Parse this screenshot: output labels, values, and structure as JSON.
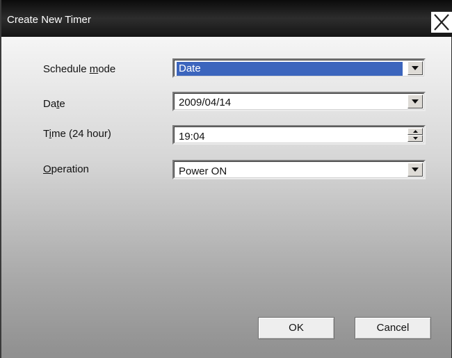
{
  "window": {
    "title": "Create New Timer",
    "close_icon": "close-x-icon"
  },
  "fields": {
    "schedule_mode": {
      "label_pre": "Schedule ",
      "label_accel": "m",
      "label_post": "ode",
      "value": "Date"
    },
    "date": {
      "label_pre": "Da",
      "label_accel": "t",
      "label_post": "e",
      "value": "2009/04/14"
    },
    "time": {
      "label_pre": "T",
      "label_accel": "i",
      "label_post": "me (24 hour)",
      "value": "19:04"
    },
    "operation": {
      "label_pre": "",
      "label_accel": "O",
      "label_post": "peration",
      "value": "Power ON"
    }
  },
  "buttons": {
    "ok": "OK",
    "cancel": "Cancel"
  },
  "colors": {
    "selection": "#3c65bd",
    "titlebar": "#1a1a1a"
  }
}
